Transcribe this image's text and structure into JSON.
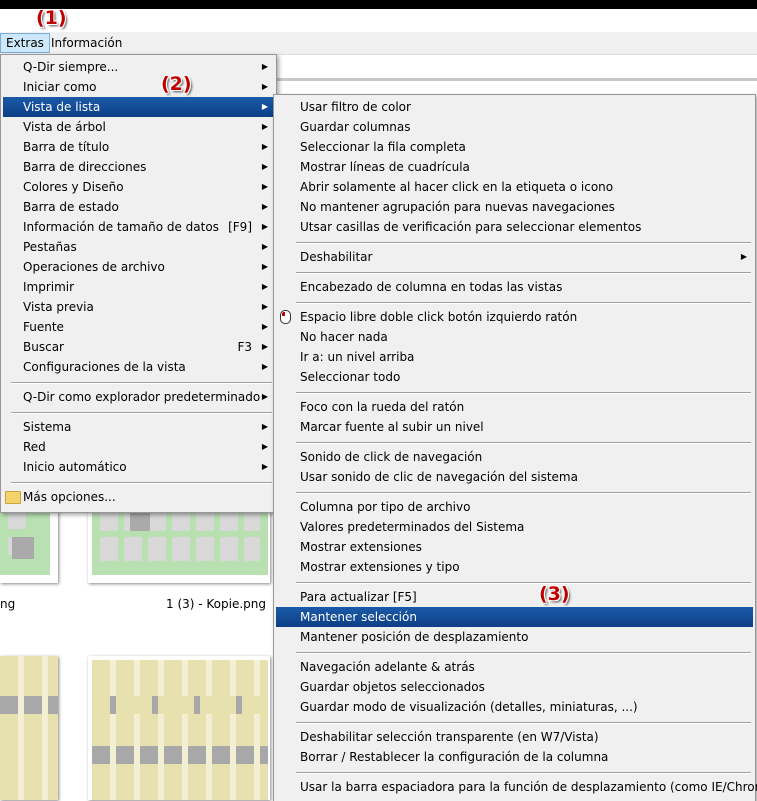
{
  "menubar": {
    "extras": "Extras",
    "informacion": "Información"
  },
  "annotations": {
    "a1": "(1)",
    "a2": "(2)",
    "a3": "(3)"
  },
  "background": {
    "file_left": "ng",
    "file_right": "1 (3) - Kopie.png"
  },
  "menu1": {
    "items": [
      "Q-Dir siempre...",
      "Iniciar como",
      "Vista de lista",
      "Vista de árbol",
      "Barra de título",
      "Barra de direcciones",
      "Colores y Diseño",
      "Barra de estado",
      "Información de tamaño de datos",
      "Pestañas",
      "Operaciones de archivo",
      "Imprimir",
      "Vista previa",
      "Fuente",
      "Buscar",
      "Configuraciones de la vista",
      "Q-Dir como explorador predeterminado",
      "Sistema",
      "Red",
      "Inicio automático",
      "Más opciones..."
    ],
    "shortcuts": {
      "f9": "[F9]",
      "f3": "F3"
    }
  },
  "menu2": {
    "items": [
      "Usar filtro de color",
      "Guardar columnas",
      "Seleccionar la fila completa",
      "Mostrar líneas de cuadrícula",
      "Abrir solamente al hacer click en la etiqueta o icono",
      "No mantener agrupación para nuevas navegaciones",
      "Utsar casillas de verificación para seleccionar elementos",
      "Deshabilitar",
      "Encabezado de columna en todas las vistas",
      "Espacio libre doble click botón izquierdo ratón",
      "No hacer nada",
      "Ir a: un nivel arriba",
      "Seleccionar todo",
      "Foco con la rueda del ratón",
      "Marcar fuente al subir un nivel",
      "Sonido de click de navegación",
      "Usar sonido de clic de navegación del sistema",
      "Columna por tipo de archivo",
      "Valores predeterminados del Sistema",
      "Mostrar extensiones",
      "Mostrar extensiones y tipo",
      "Para actualizar [F5]",
      "Mantener selección",
      "Mantener posición de desplazamiento",
      "Navegación adelante & atrás",
      "Guardar objetos seleccionados",
      "Guardar modo de visualización (detalles, miniaturas, ...)",
      "Deshabilitar selección transparente (en W7/Vista)",
      "Borrar / Restablecer la configuración de la columna",
      "Usar la barra espaciadora para la función de desplazamiento (como IE/Chrome)"
    ]
  },
  "colors": {
    "selection": "#0d3f85",
    "annotation": "#c00000"
  }
}
